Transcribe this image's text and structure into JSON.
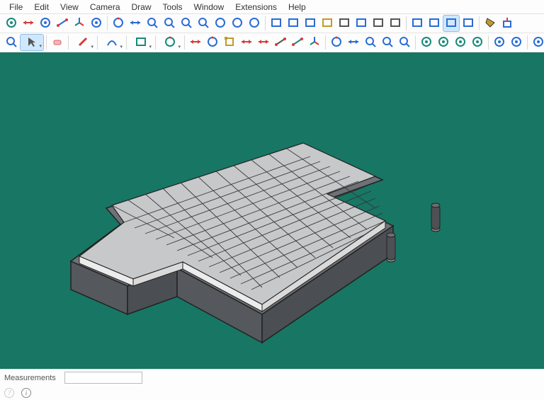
{
  "menu": {
    "items": [
      "File",
      "Edit",
      "View",
      "Camera",
      "Draw",
      "Tools",
      "Window",
      "Extensions",
      "Help"
    ]
  },
  "toolbar1": {
    "tools": [
      "make-component",
      "flip-along",
      "section-plane",
      "dimension",
      "axes",
      "text-label",
      "sep",
      "orbit",
      "pan",
      "zoom",
      "zoom-extents",
      "zoom-window",
      "zoom-previous",
      "position-camera",
      "walk",
      "look-around",
      "sep",
      "model-info",
      "entity-info",
      "3d-warehouse",
      "extension-warehouse",
      "layers",
      "outliner",
      "shadows",
      "fog",
      "sep",
      "iso",
      "top",
      "front",
      "back",
      "sep",
      "paint-bucket",
      "push-pull"
    ]
  },
  "toolbar2": {
    "tools": [
      "search",
      "select",
      "sep",
      "eraser",
      "sep",
      "pencil",
      "sep",
      "arc",
      "sep",
      "rectangle",
      "sep",
      "circle",
      "sep",
      "move",
      "rotate",
      "scale",
      "offset",
      "mirror",
      "tape-measure",
      "protractor",
      "axes-tool",
      "sep",
      "orbit-2",
      "pan-2",
      "zoom-2",
      "zoom-extents-2",
      "zoom-window-2",
      "sep",
      "styles",
      "tags",
      "scenes",
      "materials",
      "sep",
      "sandbox-1",
      "sandbox-2",
      "sep",
      "solid-1",
      "solid-2"
    ]
  },
  "status": {
    "label": "Measurements",
    "value": ""
  },
  "hints": {
    "geo": "?",
    "info": "i"
  },
  "viewport": {
    "background": "#187664"
  }
}
